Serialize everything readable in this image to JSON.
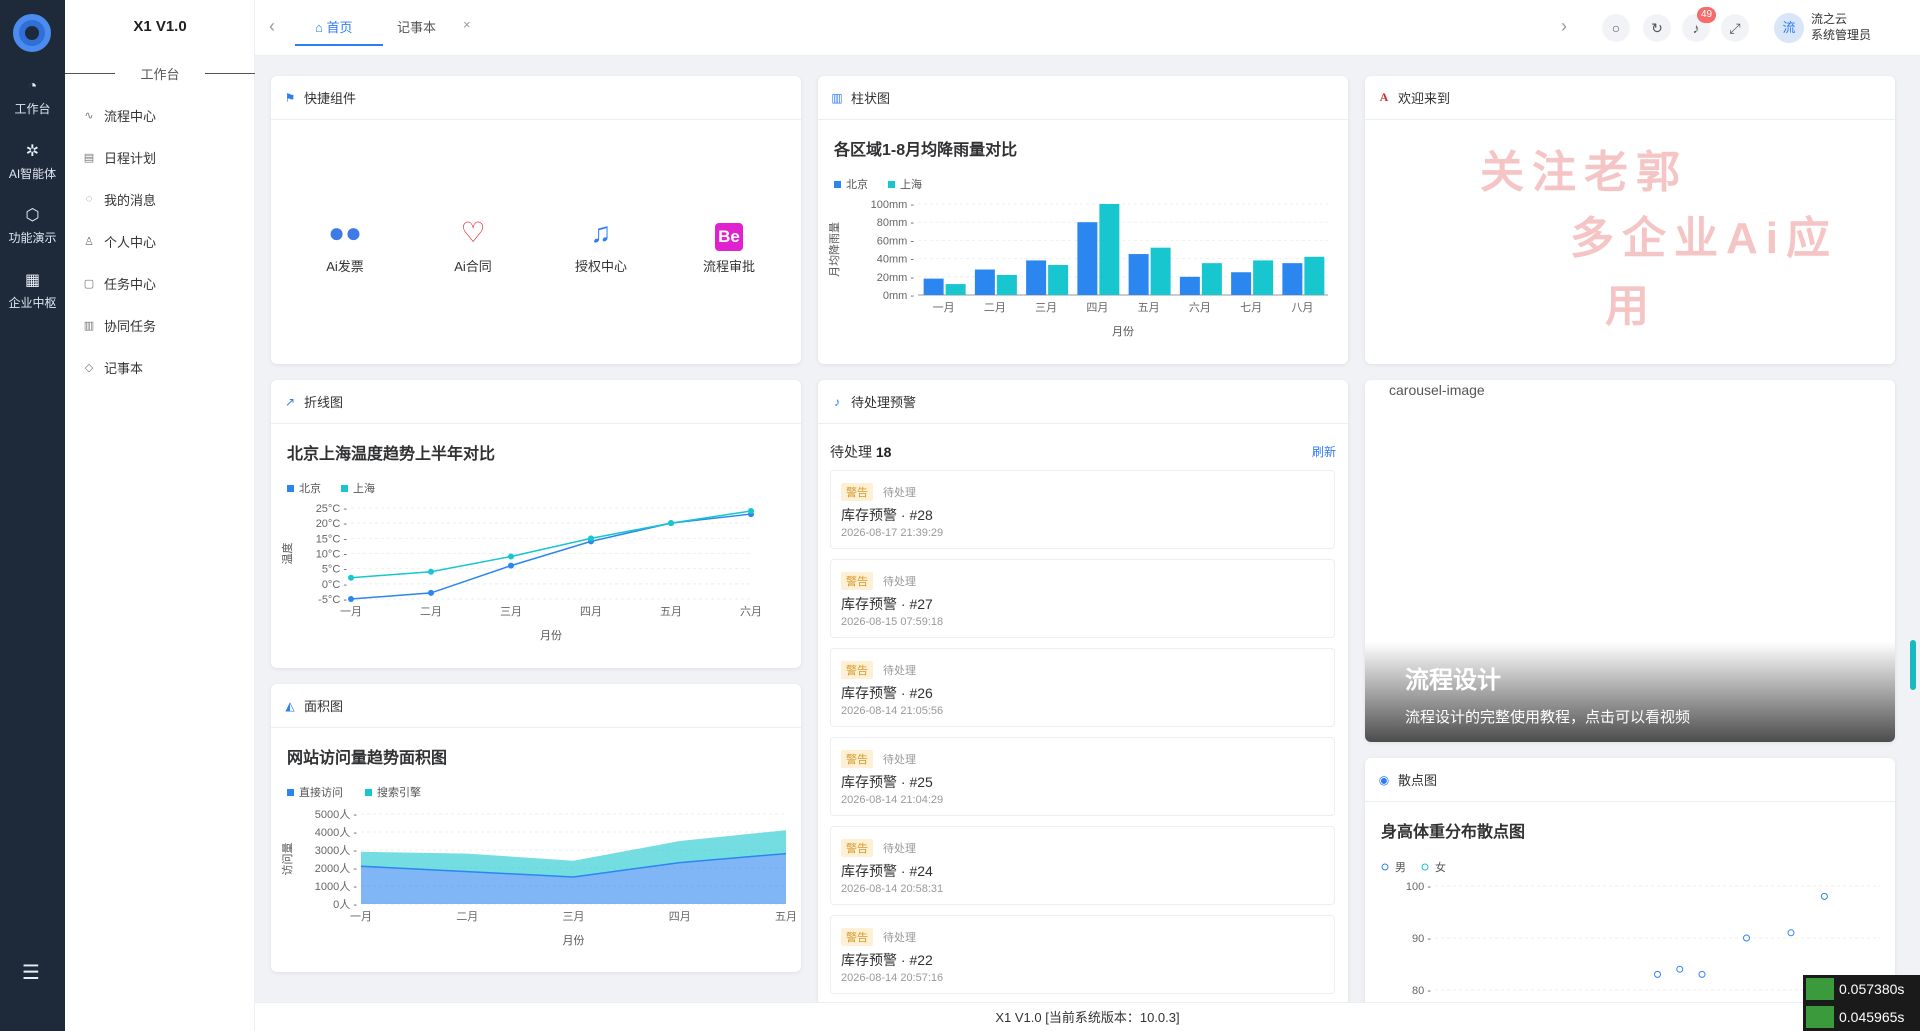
{
  "app": {
    "title": "X1 V1.0"
  },
  "rail": {
    "items": [
      {
        "label": "工作台",
        "icon": "dashboard-icon"
      },
      {
        "label": "AI智能体",
        "icon": "ai-agent-icon"
      },
      {
        "label": "功能演示",
        "icon": "cube-icon"
      },
      {
        "label": "企业中枢",
        "icon": "grid-icon"
      }
    ]
  },
  "sidebar": {
    "section": "工作台",
    "items": [
      {
        "label": "流程中心",
        "icon": "pulse-icon"
      },
      {
        "label": "日程计划",
        "icon": "calendar-icon"
      },
      {
        "label": "我的消息",
        "icon": "message-icon"
      },
      {
        "label": "个人中心",
        "icon": "user-icon"
      },
      {
        "label": "任务中心",
        "icon": "task-icon"
      },
      {
        "label": "协同任务",
        "icon": "collab-icon"
      },
      {
        "label": "记事本",
        "icon": "tag-icon"
      }
    ]
  },
  "topbar": {
    "tabs": [
      {
        "label": "首页",
        "active": true
      },
      {
        "label": "记事本",
        "active": false
      }
    ],
    "notification_count": "49",
    "avatar_text": "流",
    "user_name": "流之云",
    "user_role": "系统管理员"
  },
  "quick": {
    "title": "快捷组件",
    "items": [
      {
        "label": "Ai发票",
        "icon": "users-icon",
        "color": "#3f7be6"
      },
      {
        "label": "Ai合同",
        "icon": "heart-icon",
        "color": "#e0303a"
      },
      {
        "label": "授权中心",
        "icon": "hearing-icon",
        "color": "#2f7cf5"
      },
      {
        "label": "流程审批",
        "icon": "behance-icon",
        "color": "#e021d0"
      }
    ]
  },
  "bar_card": {
    "title": "柱状图",
    "chart_title": "各区域1-8月均降雨量对比"
  },
  "welcome": {
    "title": "欢迎来到",
    "line1": "关注老郭",
    "line2": "多企业Ai应",
    "line3": "用"
  },
  "line_card": {
    "title": "折线图",
    "chart_title": "北京上海温度趋势上半年对比"
  },
  "area_card": {
    "title": "面积图",
    "chart_title": "网站访问量趋势面积图"
  },
  "alerts": {
    "title": "待处理预警",
    "pending_label": "待处理",
    "pending_count": "18",
    "refresh": "刷新",
    "items": [
      {
        "level": "警告",
        "status": "待处理",
        "name": "库存预警 · #28",
        "time": "2026-08-17 21:39:29"
      },
      {
        "level": "警告",
        "status": "待处理",
        "name": "库存预警 · #27",
        "time": "2026-08-15 07:59:18"
      },
      {
        "level": "警告",
        "status": "待处理",
        "name": "库存预警 · #26",
        "time": "2026-08-14 21:05:56"
      },
      {
        "level": "警告",
        "status": "待处理",
        "name": "库存预警 · #25",
        "time": "2026-08-14 21:04:29"
      },
      {
        "level": "警告",
        "status": "待处理",
        "name": "库存预警 · #24",
        "time": "2026-08-14 20:58:31"
      },
      {
        "level": "警告",
        "status": "待处理",
        "name": "库存预警 · #22",
        "time": "2026-08-14 20:57:16"
      }
    ]
  },
  "carousel": {
    "alt": "carousel-image",
    "title": "流程设计",
    "desc": "流程设计的完整使用教程，点击可以看视频"
  },
  "scatter_card": {
    "title": "散点图",
    "chart_title": "身高体重分布散点图"
  },
  "footer": {
    "text": "X1 V1.0 [当前系统版本：10.0.3]"
  },
  "timings": [
    "0.057380s",
    "0.045965s"
  ],
  "chart_data": [
    {
      "type": "bar",
      "title": "各区域1-8月均降雨量对比",
      "xlabel": "月份",
      "ylabel": "月均降雨量",
      "categories": [
        "一月",
        "二月",
        "三月",
        "四月",
        "五月",
        "六月",
        "七月",
        "八月"
      ],
      "ylim": [
        0,
        100
      ],
      "yticks": [
        "0mm",
        "20mm",
        "40mm",
        "60mm",
        "80mm",
        "100mm"
      ],
      "legend": "top-left",
      "series": [
        {
          "name": "北京",
          "color": "#2b86f0",
          "values": [
            18,
            28,
            38,
            80,
            45,
            20,
            25,
            35
          ]
        },
        {
          "name": "上海",
          "color": "#17c6cf",
          "values": [
            12,
            22,
            33,
            100,
            52,
            35,
            38,
            42
          ]
        }
      ]
    },
    {
      "type": "line",
      "title": "北京上海温度趋势上半年对比",
      "xlabel": "月份",
      "ylabel": "温度",
      "categories": [
        "一月",
        "二月",
        "三月",
        "四月",
        "五月",
        "六月"
      ],
      "ylim": [
        -5,
        25
      ],
      "yticks": [
        "-5°C",
        "0°C",
        "5°C",
        "10°C",
        "15°C",
        "20°C",
        "25°C"
      ],
      "legend": "top-left",
      "series": [
        {
          "name": "北京",
          "color": "#2b86f0",
          "values": [
            -5,
            -3,
            6,
            14,
            20,
            23
          ]
        },
        {
          "name": "上海",
          "color": "#17c6cf",
          "values": [
            2,
            4,
            9,
            15,
            20,
            24
          ]
        }
      ]
    },
    {
      "type": "area",
      "title": "网站访问量趋势面积图",
      "xlabel": "月份",
      "ylabel": "访问量",
      "categories": [
        "一月",
        "二月",
        "三月",
        "四月",
        "五月"
      ],
      "ylim": [
        0,
        5000
      ],
      "yticks": [
        "0人",
        "1000人",
        "2000人",
        "3000人",
        "4000人",
        "5000人"
      ],
      "legend": "top-left",
      "series": [
        {
          "name": "直接访问",
          "color": "#2b86f0",
          "values": [
            2100,
            1800,
            1500,
            2300,
            2800
          ]
        },
        {
          "name": "搜索引擎",
          "color": "#17c6cf",
          "values": [
            800,
            1000,
            900,
            1200,
            1300
          ]
        }
      ]
    },
    {
      "type": "scatter",
      "title": "身高体重分布散点图",
      "ylim": [
        80,
        100
      ],
      "yticks": [
        "80",
        "90",
        "100"
      ],
      "legend": "top-left",
      "series": [
        {
          "name": "男",
          "color": "#2b86f0",
          "points": [
            [
              175,
              98
            ],
            [
              168,
              90
            ],
            [
              172,
              91
            ],
            [
              160,
              83
            ],
            [
              162,
              84
            ],
            [
              164,
              83
            ]
          ]
        },
        {
          "name": "女",
          "color": "#17c6cf",
          "points": []
        }
      ]
    }
  ]
}
